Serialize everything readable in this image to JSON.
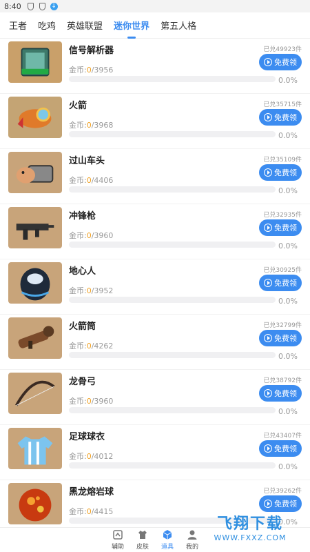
{
  "status": {
    "time": "8:40"
  },
  "tabs": [
    {
      "label": "王者",
      "active": false
    },
    {
      "label": "吃鸡",
      "active": false
    },
    {
      "label": "英雄联盟",
      "active": false
    },
    {
      "label": "迷你世界",
      "active": true
    },
    {
      "label": "第五人格",
      "active": false
    }
  ],
  "coin_label": "金币:",
  "free_label": "免费领",
  "items": [
    {
      "name": "信号解析器",
      "coins_current": "0",
      "coins_total": "/3956",
      "redeemed": "已兑49923件",
      "progress": "0.0%",
      "progress_fraction": 0.0,
      "icon": "signal-decoder-icon"
    },
    {
      "name": "火箭",
      "coins_current": "0",
      "coins_total": "/3968",
      "redeemed": "已兑35715件",
      "progress": "0.0%",
      "progress_fraction": 0.0,
      "icon": "rocket-icon"
    },
    {
      "name": "过山车头",
      "coins_current": "0",
      "coins_total": "/4406",
      "redeemed": "已兑35109件",
      "progress": "0.0%",
      "progress_fraction": 0.0,
      "icon": "coaster-head-icon"
    },
    {
      "name": "冲锋枪",
      "coins_current": "0",
      "coins_total": "/3960",
      "redeemed": "已兑32935件",
      "progress": "0.0%",
      "progress_fraction": 0.0,
      "icon": "smg-icon"
    },
    {
      "name": "地心人",
      "coins_current": "0",
      "coins_total": "/3952",
      "redeemed": "已兑30925件",
      "progress": "0.0%",
      "progress_fraction": 0.0,
      "icon": "core-creature-icon"
    },
    {
      "name": "火箭筒",
      "coins_current": "0",
      "coins_total": "/4262",
      "redeemed": "已兑32799件",
      "progress": "0.0%",
      "progress_fraction": 0.0,
      "icon": "bazooka-icon"
    },
    {
      "name": "龙骨弓",
      "coins_current": "0",
      "coins_total": "/3960",
      "redeemed": "已兑38792件",
      "progress": "0.0%",
      "progress_fraction": 0.0,
      "icon": "bone-bow-icon"
    },
    {
      "name": "足球球衣",
      "coins_current": "0",
      "coins_total": "/4012",
      "redeemed": "已兑43407件",
      "progress": "0.0%",
      "progress_fraction": 0.0,
      "icon": "jersey-icon"
    },
    {
      "name": "黑龙熔岩球",
      "coins_current": "0",
      "coins_total": "/4415",
      "redeemed": "已兑39262件",
      "progress": "0.0%",
      "progress_fraction": 0.0,
      "icon": "lava-ball-icon"
    }
  ],
  "bottom_nav": [
    {
      "label": "辅助",
      "icon": "assist-icon",
      "active": false
    },
    {
      "label": "皮肤",
      "icon": "shirt-icon",
      "active": false
    },
    {
      "label": "道具",
      "icon": "cube-icon",
      "active": true
    },
    {
      "label": "我的",
      "icon": "person-icon",
      "active": false
    }
  ],
  "watermark": {
    "text": "飞翔下载",
    "url": "WWW.FXXZ.COM"
  },
  "colors": {
    "accent": "#3c8cf0",
    "coin": "#f0a020"
  }
}
